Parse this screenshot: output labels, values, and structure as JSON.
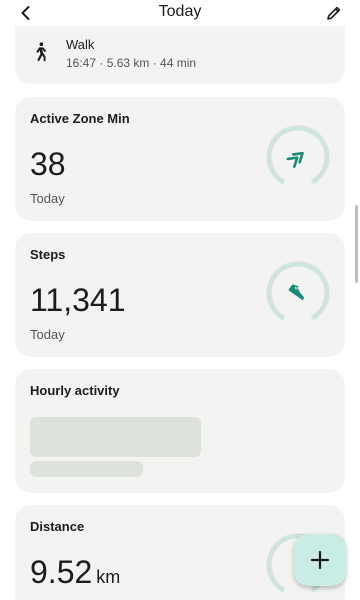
{
  "header": {
    "title": "Today",
    "back_icon": "chevron-left-icon",
    "edit_icon": "pencil-icon"
  },
  "walk": {
    "label": "Walk",
    "meta": "16:47 · 5.63 km · 44 min",
    "icon": "walking-person-icon"
  },
  "active_zone": {
    "title": "Active Zone Min",
    "value": "38",
    "period": "Today",
    "icon": "double-chevron-icon"
  },
  "steps": {
    "title": "Steps",
    "value": "11,341",
    "period": "Today",
    "icon": "shoe-icon"
  },
  "hourly": {
    "title": "Hourly activity"
  },
  "distance": {
    "title": "Distance",
    "value": "9.52",
    "unit": "km"
  },
  "fab": {
    "icon": "plus-icon"
  },
  "colors": {
    "accent": "#1a8a76",
    "ring_track": "#cfe3df",
    "card_bg": "#f3f4f1",
    "fab_bg": "#c9ece4"
  }
}
